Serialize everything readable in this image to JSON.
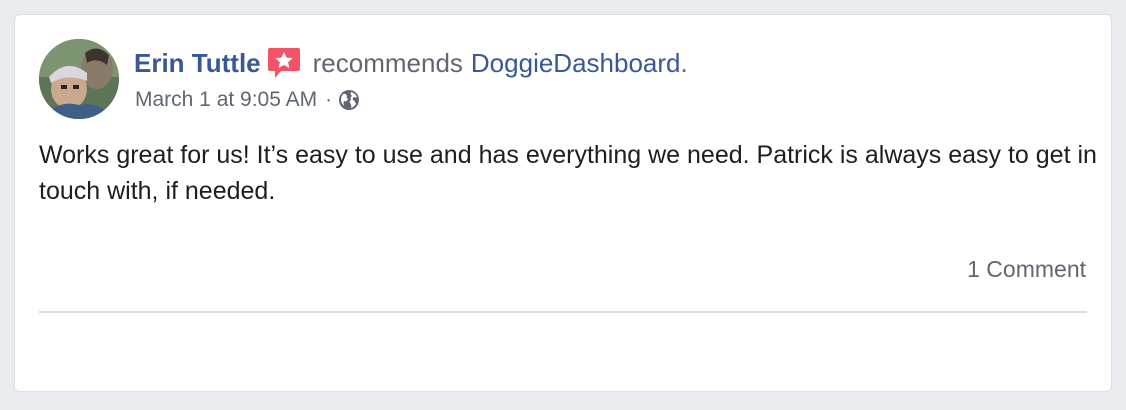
{
  "post": {
    "author": "Erin Tuttle",
    "action": "recommends",
    "page": "DoggieDashboard",
    "period": ".",
    "timestamp": "March 1 at 9:05 AM",
    "separator": "·",
    "privacy_icon": "globe-icon",
    "recommend_badge_icon": "star-speech-bubble-icon",
    "body": "Works great for us! It’s easy to use and has everything we need. Patrick is always easy to get in touch with, if needed.",
    "comments_count": "1 Comment"
  },
  "colors": {
    "link": "#385898",
    "secondary_text": "#606770",
    "primary_text": "#1c1e21",
    "badge": "#f35369",
    "background": "#e9ebee"
  }
}
